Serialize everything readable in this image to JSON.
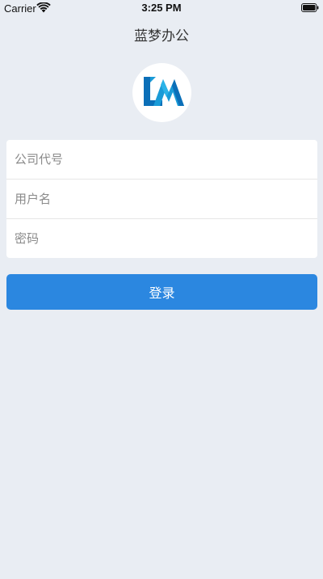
{
  "status_bar": {
    "carrier": "Carrier",
    "time": "3:25 PM",
    "wifi_icon": "wifi-icon",
    "battery_icon": "battery-icon"
  },
  "header": {
    "title": "蓝梦办公"
  },
  "logo": {
    "icon": "app-logo-icon",
    "colors": [
      "#1a9bd7",
      "#0b6fb8",
      "#2bb3e8"
    ]
  },
  "form": {
    "company_code": {
      "placeholder": "公司代号",
      "value": ""
    },
    "username": {
      "placeholder": "用户名",
      "value": ""
    },
    "password": {
      "placeholder": "密码",
      "value": ""
    }
  },
  "actions": {
    "login_label": "登录"
  },
  "colors": {
    "background": "#e9edf3",
    "primary": "#2b87e0"
  }
}
